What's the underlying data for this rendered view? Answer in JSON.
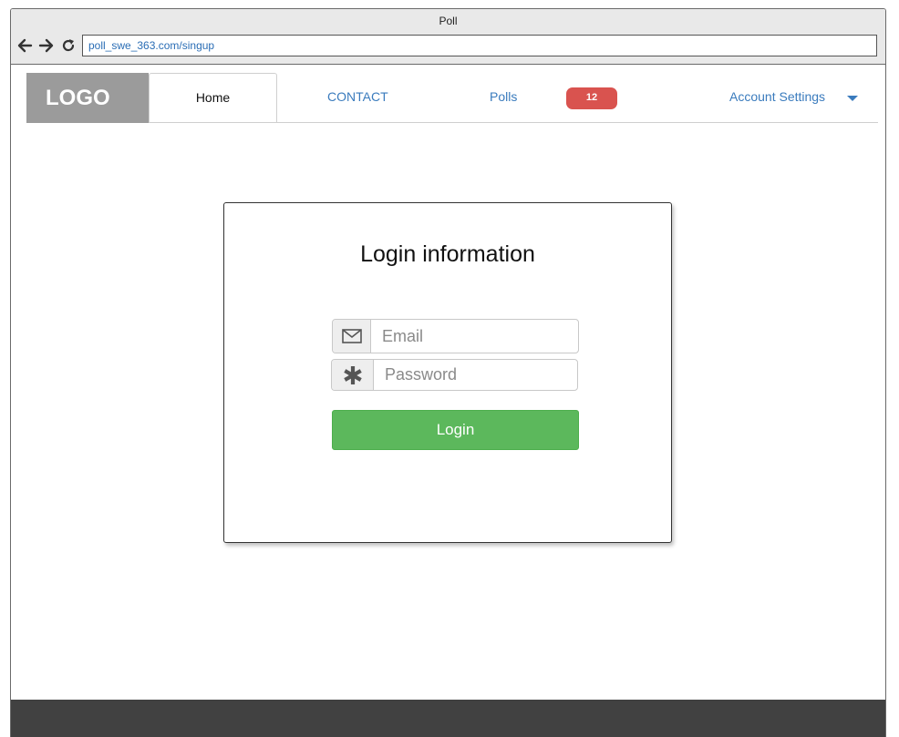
{
  "window": {
    "title": "Poll"
  },
  "browser": {
    "url": "poll_swe_363.com/singup"
  },
  "nav": {
    "logo": "LOGO",
    "home": "Home",
    "contact": "CONTACT",
    "polls": "Polls",
    "polls_badge": "12",
    "account": "Account Settings"
  },
  "login": {
    "title": "Login information",
    "email_placeholder": "Email",
    "password_placeholder": "Password",
    "button": "Login"
  },
  "colors": {
    "accent": "#3a7bbd",
    "badge": "#d9534f",
    "login_button": "#5cb85c",
    "logo_bg": "#9b9b9b",
    "footer": "#414141"
  },
  "icons": [
    "back-arrow-icon",
    "forward-arrow-icon",
    "reload-icon",
    "dropdown-caret-icon",
    "envelope-icon",
    "asterisk-icon"
  ]
}
